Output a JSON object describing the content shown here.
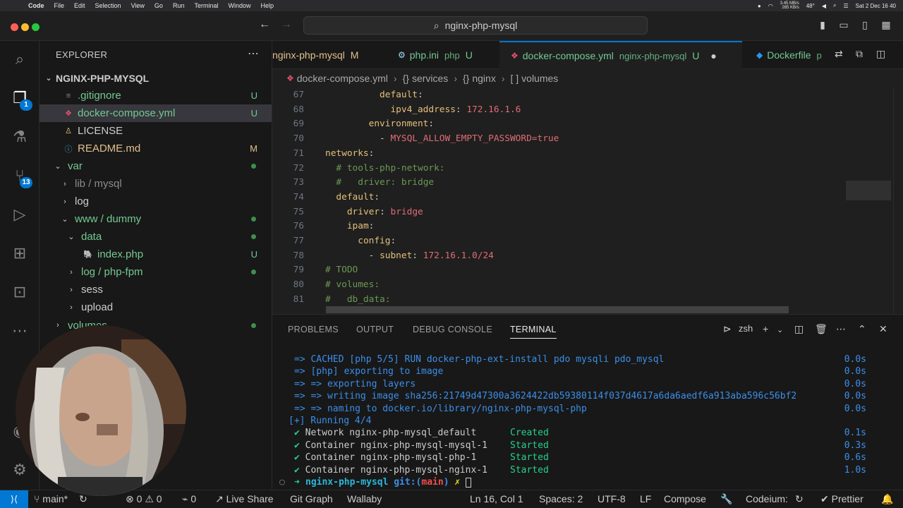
{
  "menubar": {
    "app": "Code",
    "items": [
      "File",
      "Edit",
      "Selection",
      "View",
      "Go",
      "Run",
      "Terminal",
      "Window",
      "Help"
    ],
    "net_up": "3.45 MB/s",
    "net_down": "285 KB/s",
    "temp": "48°",
    "clock": "Sat 2 Dec 16 40"
  },
  "titlebar": {
    "search": "nginx-php-mysql"
  },
  "activity": {
    "explorer_badge": "1",
    "scm_badge": "13"
  },
  "sidebar": {
    "title": "EXPLORER",
    "root": "NGINX-PHP-MYSQL",
    "items": [
      {
        "label": ".gitignore",
        "status": "U"
      },
      {
        "label": "docker-compose.yml",
        "status": "U"
      },
      {
        "label": "LICENSE",
        "status": ""
      },
      {
        "label": "README.md",
        "status": "M"
      },
      {
        "label": "var",
        "status": ""
      },
      {
        "label": "lib / mysql",
        "status": ""
      },
      {
        "label": "log",
        "status": ""
      },
      {
        "label": "www / dummy",
        "status": ""
      },
      {
        "label": "data",
        "status": ""
      },
      {
        "label": "index.php",
        "status": "U"
      },
      {
        "label": "log / php-fpm",
        "status": ""
      },
      {
        "label": "sess",
        "status": ""
      },
      {
        "label": "upload",
        "status": ""
      },
      {
        "label": "volumes",
        "status": ""
      }
    ]
  },
  "tabs": [
    {
      "label": "nginx-php-mysql",
      "status": "M"
    },
    {
      "label": "php.ini",
      "sub": "php",
      "status": "U"
    },
    {
      "label": "docker-compose.yml",
      "sub": "nginx-php-mysql",
      "status": "U"
    },
    {
      "label": "Dockerfile",
      "sub": "p"
    }
  ],
  "breadcrumb": {
    "file": "docker-compose.yml",
    "b1": "services",
    "b2": "nginx",
    "b3": "volumes"
  },
  "code": [
    {
      "n": "67",
      "t": "          default:"
    },
    {
      "n": "68",
      "t": "            ipv4_address: 172.16.1.6"
    },
    {
      "n": "69",
      "t": "        environment:"
    },
    {
      "n": "70",
      "t": "          - MYSQL_ALLOW_EMPTY_PASSWORD=true"
    },
    {
      "n": "71",
      "t": "networks:"
    },
    {
      "n": "72",
      "t": "  # tools-php-network:"
    },
    {
      "n": "73",
      "t": "  #   driver: bridge"
    },
    {
      "n": "74",
      "t": "  default:"
    },
    {
      "n": "75",
      "t": "    driver: bridge"
    },
    {
      "n": "76",
      "t": "    ipam:"
    },
    {
      "n": "77",
      "t": "      config:"
    },
    {
      "n": "78",
      "t": "        - subnet: 172.16.1.0/24"
    },
    {
      "n": "79",
      "t": "# TODO"
    },
    {
      "n": "80",
      "t": "# volumes:"
    },
    {
      "n": "81",
      "t": "#   db_data:"
    }
  ],
  "panel": {
    "tabs": [
      "PROBLEMS",
      "OUTPUT",
      "DEBUG CONSOLE",
      "TERMINAL"
    ],
    "shell": "zsh"
  },
  "terminal": [
    {
      "text": "=> CACHED [php 5/5] RUN docker-php-ext-install pdo mysqli pdo_mysql",
      "time": "0.0s"
    },
    {
      "text": "=> [php] exporting to image",
      "time": "0.0s"
    },
    {
      "text": "=> => exporting layers",
      "time": "0.0s"
    },
    {
      "text": "=> => writing image sha256:21749d47300a3624422db59380114f037d4617a6da6aedf6a913aba596c56bf2",
      "time": "0.0s"
    },
    {
      "text": "=> => naming to docker.io/library/nginx-php-mysql-php",
      "time": "0.0s"
    },
    {
      "text": "[+] Running 4/4",
      "time": ""
    },
    {
      "text": "✔ Network nginx-php-mysql_default",
      "status": "Created",
      "time": "0.1s"
    },
    {
      "text": "✔ Container nginx-php-mysql-mysql-1",
      "status": "Started",
      "time": "0.3s"
    },
    {
      "text": "✔ Container nginx-php-mysql-php-1",
      "status": "Started",
      "time": "0.6s"
    },
    {
      "text": "✔ Container nginx-php-mysql-nginx-1",
      "status": "Started",
      "time": "1.0s"
    }
  ],
  "prompt": {
    "dir": "nginx-php-mysql",
    "git": "git:(",
    "branch": "main",
    "close": ")",
    "mark": "✗"
  },
  "status": {
    "branch": "main*",
    "errors": "0",
    "warnings": "0",
    "ports": "0",
    "live_share": "Live Share",
    "git_graph": "Git Graph",
    "wallaby": "Wallaby",
    "position": "Ln 16, Col 1",
    "spaces": "Spaces: 2",
    "encoding": "UTF-8",
    "eol": "LF",
    "language": "Compose",
    "codeium": "Codeium:",
    "prettier": "Prettier"
  },
  "colors": {
    "accent": "#0078d4",
    "git_untracked": "#73c991",
    "git_modified": "#e2c08d"
  }
}
